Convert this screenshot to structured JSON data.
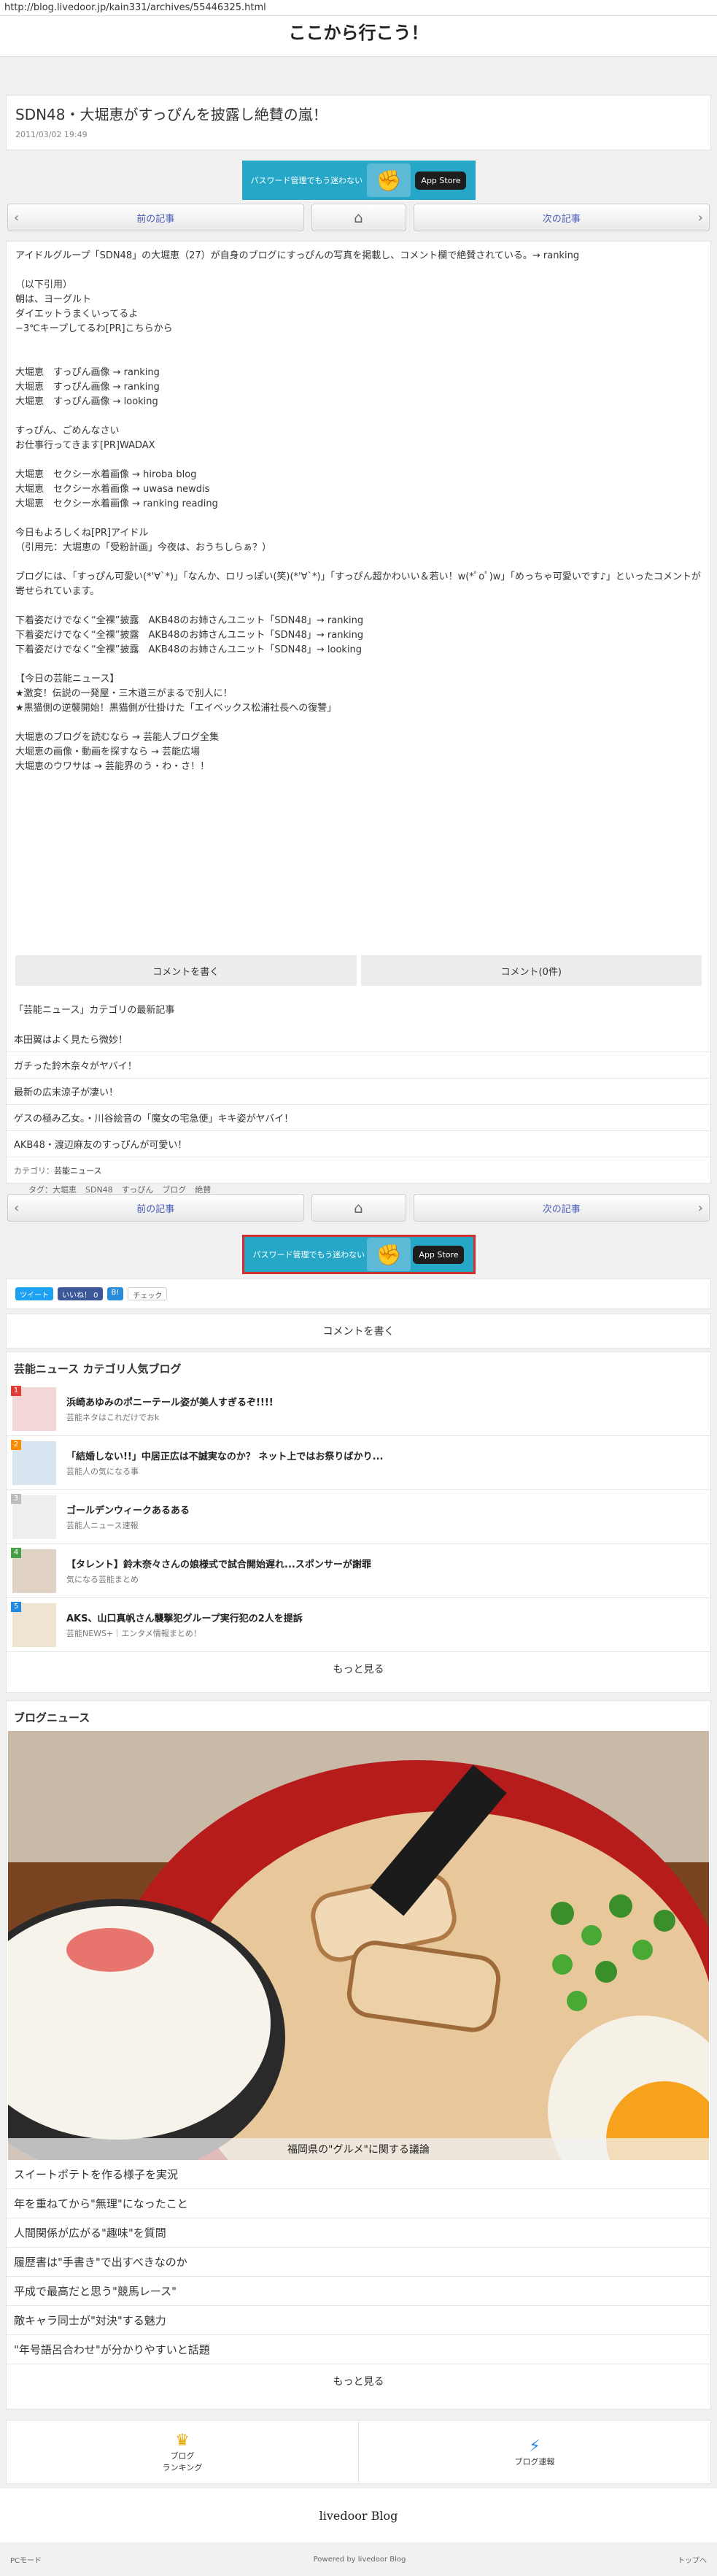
{
  "url": "http://blog.livedoor.jp/kain331/archives/55446325.html",
  "blog_title": "ここから行こう！",
  "post": {
    "title": "SDN48・大堀恵がすっぴんを披露し絶賛の嵐！",
    "date": "2011/03/02 19:49",
    "banner": {
      "left": "パスワード管理でもう迷わない",
      "right": "App Store"
    },
    "nav": {
      "prev": "前の記事",
      "next": "次の記事"
    },
    "lines": [
      "アイドルグループ「SDN48」の大堀恵（27）が自身のブログにすっぴんの写真を掲載し、コメント欄で絶賛されている。→ ranking",
      "",
      "（以下引用）",
      "朝は、ヨーグルト",
      "ダイエットうまくいってるよ",
      "−3℃キープしてるわ[PR]こちらから",
      "",
      "",
      "大堀恵　すっぴん画像 → ranking",
      "大堀恵　すっぴん画像 → ranking",
      "大堀恵　すっぴん画像 → looking",
      "",
      "すっぴん、ごめんなさい",
      "お仕事行ってきます[PR]WADAX",
      "",
      "大堀恵　セクシー水着画像 → hiroba blog",
      "大堀恵　セクシー水着画像 → uwasa newdis",
      "大堀恵　セクシー水着画像 → ranking reading",
      "",
      "今日もよろしくね[PR]アイドル",
      "（引用元：大堀恵の「受粉計画」今夜は、おうちしらぁ？）",
      "",
      "ブログには、「すっぴん可愛い(*'∀`*)」「なんか、ロリっぽい(笑)(*'∀`*)」「すっぴん超かわいい＆若い！w(*ﾟoﾟ)w」「めっちゃ可愛いです♪」といったコメントが寄せられています。",
      "",
      "下着姿だけでなく“全裸”披露　AKB48のお姉さんユニット「SDN48」→ ranking",
      "下着姿だけでなく“全裸”披露　AKB48のお姉さんユニット「SDN48」→ ranking",
      "下着姿だけでなく“全裸”披露　AKB48のお姉さんユニット「SDN48」→ looking",
      "",
      "【今日の芸能ニュース】",
      "★激変！伝説の一発屋・三木道三がまるで別人に！",
      "★黒猫側の逆襲開始！黒猫側が仕掛けた「エイベックス松浦社長への復讐」",
      "",
      "大堀恵のブログを読むなら → 芸能人ブログ全集",
      "大堀恵の画像・動画を探すなら → 芸能広場",
      "大堀恵のウワサは → 芸能界のう・わ・さ！！"
    ],
    "comment_write": "コメントを書く",
    "comment_count": "コメント(0件)",
    "recent_heading": "「芸能ニュース」カテゴリの最新記事",
    "recent": [
      "本田翼はよく見たら微妙！",
      "ガチった鈴木奈々がヤバイ！",
      "最新の広末涼子が凄い！",
      "ゲスの極み乙女。・川谷絵音の「魔女の宅急便」キキ姿がヤバイ！",
      "AKB48・渡辺麻友のすっぴんが可愛い！"
    ],
    "category_label": "カテゴリ：",
    "category": "芸能ニュース",
    "tags_label": "タグ：",
    "tags": [
      "大堀恵",
      "SDN48",
      "すっぴん",
      "ブログ",
      "絶賛"
    ]
  },
  "social": {
    "tweet": "ツイート",
    "like": "いいね！ 0",
    "b": "B!",
    "check": "チェック"
  },
  "comment_write2": "コメントを書く",
  "popular": {
    "title": "芸能ニュース カテゴリ人気ブログ",
    "items": [
      {
        "rank": "1",
        "title": "浜崎あゆみのポニーテール姿が美人すぎるぞ!!!!",
        "sub": "芸能ネタはこれだけでおk"
      },
      {
        "rank": "2",
        "title": "「結婚しない!!」中居正広は不誠実なのか？ ネット上ではお祭りばかり...",
        "sub": "芸能人の気になる事"
      },
      {
        "rank": "3",
        "title": "ゴールデンウィークあるある",
        "sub": "芸能人ニュース速報"
      },
      {
        "rank": "4",
        "title": "【タレント】鈴木奈々さんの娘様式で試合開始遅れ...スポンサーが謝罪",
        "sub": "気になる芸能まとめ"
      },
      {
        "rank": "5",
        "title": "AKS、山口真帆さん襲撃犯グループ実行犯の2人を提訴",
        "sub": "芸能NEWS+｜エンタメ情報まとめ！"
      }
    ],
    "more": "もっと見る"
  },
  "blognews": {
    "title": "ブログニュース",
    "caption": "福岡県の\"グルメ\"に関する議論",
    "items": [
      "スイートポテトを作る様子を実況",
      "年を重ねてから\"無理\"になったこと",
      "人間関係が広がる\"趣味\"を質問",
      "履歴書は\"手書き\"で出すべきなのか",
      "平成で最高だと思う\"競馬レース\"",
      "敵キャラ同士が\"対決\"する魅力",
      "\"年号語呂合わせ\"が分かりやすいと話題"
    ],
    "more": "もっと見る"
  },
  "footer": {
    "ranking": "ブログ\nランキング",
    "alert": "ブログ速報",
    "logo": "livedoor Blog",
    "pc": "PCモード",
    "powered": "Powered by livedoor Blog",
    "top": "トップへ"
  }
}
